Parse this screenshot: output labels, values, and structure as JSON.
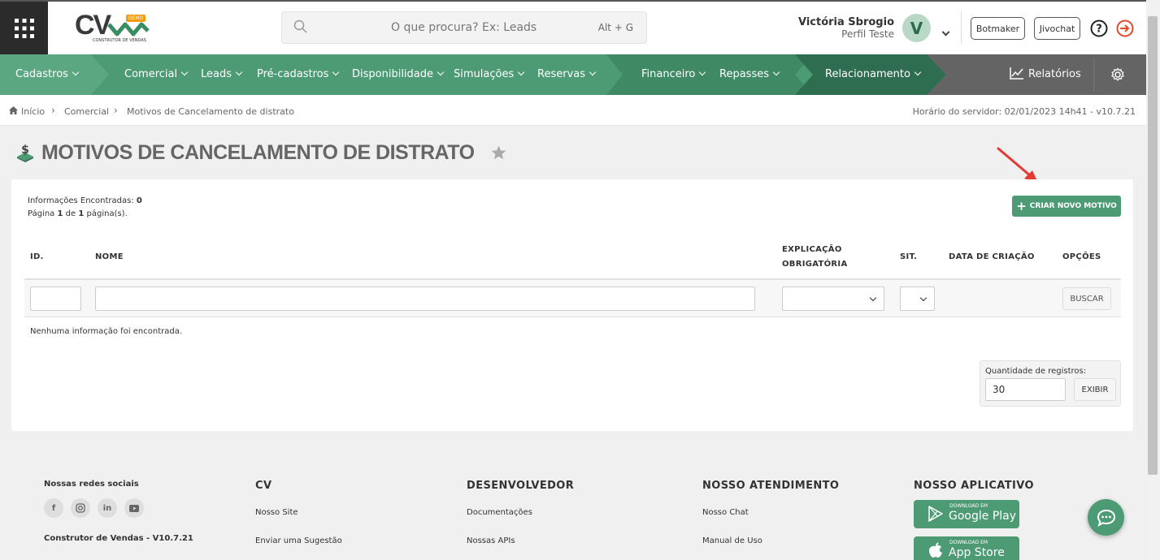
{
  "logo": {
    "text": "CV",
    "badge": "DEMO",
    "subtitle": "CONSTRUTOR DE VENDAS"
  },
  "search": {
    "placeholder": "O que procura? Ex: Leads",
    "shortcut": "Alt + G"
  },
  "user": {
    "name": "Victória Sbrogio",
    "profile": "Perfil Teste",
    "initial": "V",
    "avatar_color": "#b9d9c6"
  },
  "header_buttons": [
    "Botmaker",
    "Jivochat"
  ],
  "nav": {
    "items": [
      {
        "label": "Cadastros"
      },
      {
        "label": "Comercial"
      },
      {
        "label": "Leads"
      },
      {
        "label": "Pré-cadastros"
      },
      {
        "label": "Disponibilidade"
      },
      {
        "label": "Simulações"
      },
      {
        "label": "Reservas"
      },
      {
        "label": "Financeiro"
      },
      {
        "label": "Repasses"
      },
      {
        "label": "Relacionamento"
      }
    ],
    "reports": "Relatórios"
  },
  "colors": {
    "primary": "#4c9b74",
    "nav_dark": "#2f6d50",
    "reports_bg": "#646464",
    "logout": "#e04a2a",
    "arrow": "#e53935"
  },
  "breadcrumb": {
    "home": "Início",
    "level1": "Comercial",
    "level2": "Motivos de Cancelamento de distrato",
    "server_time": "Horário do servidor: 02/01/2023 14h41 - v10.7.21"
  },
  "page": {
    "title": "MOTIVOS DE CANCELAMENTO DE DISTRATO"
  },
  "info": {
    "found_label": "Informações Encontradas:",
    "found_count": "0",
    "page_prefix": "Página",
    "page_current": "1",
    "page_of": "de",
    "page_total": "1",
    "page_suffix": "página(s)."
  },
  "new_button": "CRIAR NOVO MOTIVO",
  "table": {
    "columns": {
      "id": "ID.",
      "name": "NOME",
      "explanation_1": "EXPLICAÇÃO",
      "explanation_2": "OBRIGATÓRIA",
      "situation": "SIT.",
      "created": "DATA DE CRIAÇÃO",
      "options": "OPÇÕES"
    },
    "search_button": "BUSCAR",
    "empty": "Nenhuma informação foi encontrada."
  },
  "pagination": {
    "label": "Quantidade de registros:",
    "value": "30",
    "button": "EXIBIR"
  },
  "footer": {
    "social_title": "Nossas redes sociais",
    "version": "Construtor de Vendas - V10.7.21",
    "cv": {
      "title": "CV",
      "links": [
        "Nosso Site",
        "Enviar uma Sugestão"
      ]
    },
    "dev": {
      "title": "DESENVOLVEDOR",
      "links": [
        "Documentações",
        "Nossas APIs"
      ]
    },
    "support": {
      "title": "NOSSO ATENDIMENTO",
      "links": [
        "Nosso Chat",
        "Manual de Uso"
      ]
    },
    "app": {
      "title": "NOSSO APLICATIVO",
      "google_small": "DOWNLOAD EM",
      "google": "Google Play",
      "apple_small": "DOWNLOAD EM",
      "apple": "App Store"
    }
  }
}
